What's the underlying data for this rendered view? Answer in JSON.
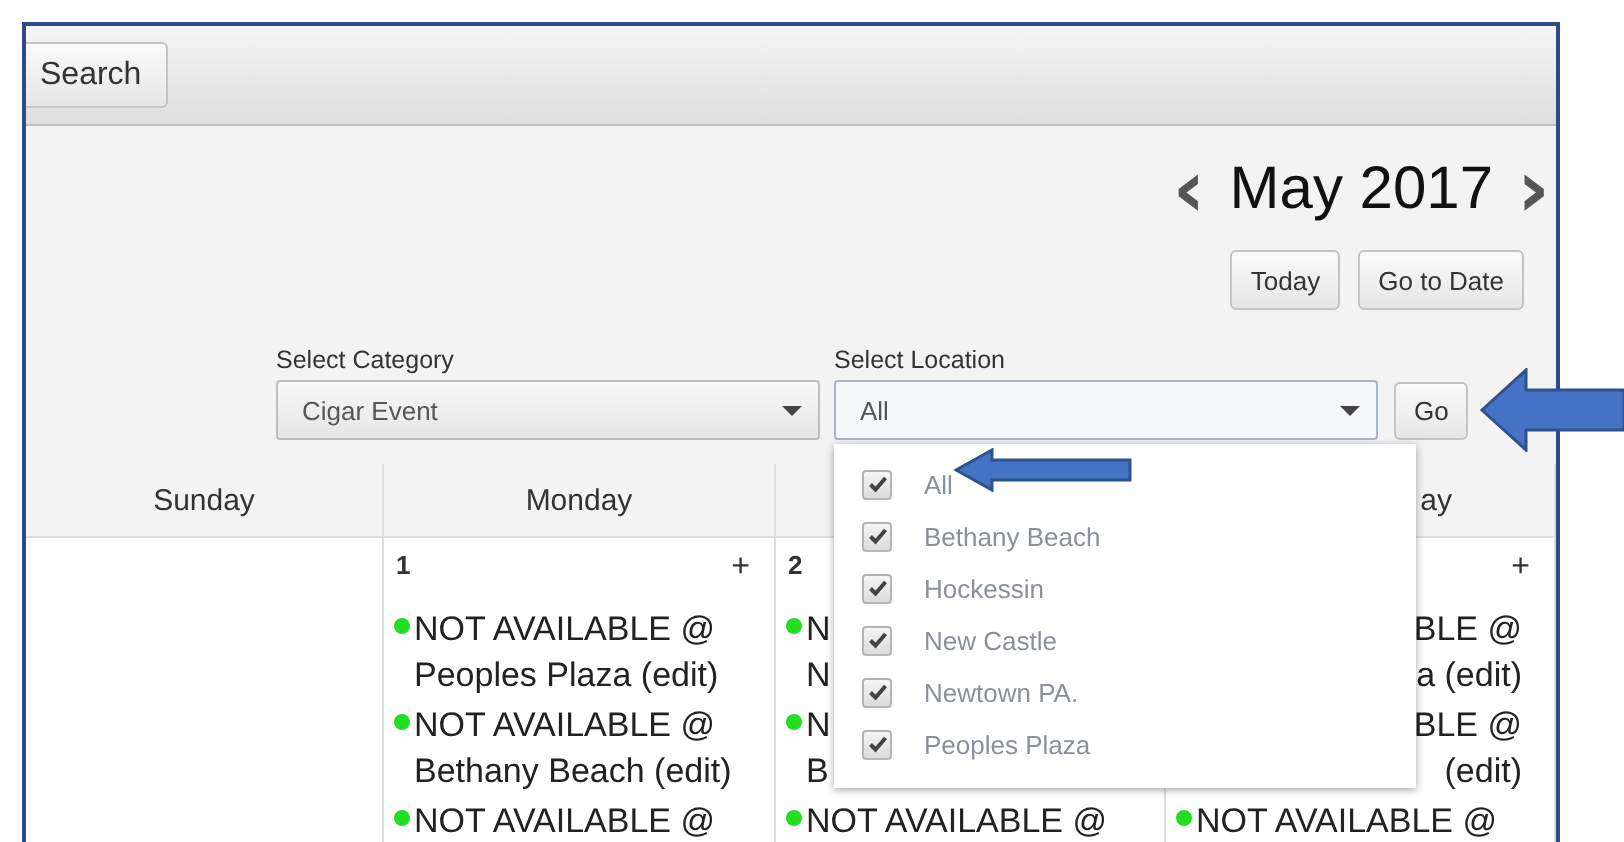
{
  "toolbar": {
    "search_button": "Search"
  },
  "navigation": {
    "prev": "‹",
    "month": "May 2017",
    "next": "›",
    "buttons": [
      "Today",
      "Go to Date"
    ]
  },
  "filters": {
    "category": {
      "label": "Select Category",
      "value": "Cigar Event"
    },
    "location": {
      "label": "Select Location",
      "value": "All",
      "expanded": true
    },
    "go_button": "Go"
  },
  "calendar": {
    "columns": [
      {
        "label": "Sunday",
        "kind": "full"
      },
      {
        "label": "Monday",
        "kind": "full"
      },
      {
        "kind": "hidden"
      },
      {
        "label": "ay",
        "kind": "partial"
      }
    ],
    "cells": [
      {},
      {
        "date": "1",
        "add": "+",
        "events": [
          {
            "kind": "full",
            "lines": [
              "NOT AVAILABLE @",
              "Peoples Plaza (edit)"
            ]
          },
          {
            "kind": "full",
            "lines": [
              "NOT AVAILABLE @",
              "Bethany Beach (edit)"
            ]
          },
          {
            "kind": "full",
            "lines": [
              "NOT AVAILABLE @"
            ]
          }
        ]
      },
      {
        "date": "2",
        "events": [
          {
            "kind": "full",
            "lines": [
              "N",
              "N"
            ]
          },
          {
            "kind": "full",
            "lines": [
              "N",
              "B"
            ]
          },
          {
            "kind": "full",
            "lines": [
              "NOT AVAILABLE @"
            ]
          }
        ]
      },
      {
        "add": "+",
        "events": [
          {
            "kind": "partial",
            "lines": [
              "BLE @",
              "a (edit)"
            ]
          },
          {
            "kind": "partial",
            "lines": [
              "BLE @",
              "(edit)"
            ]
          },
          {
            "kind": "full",
            "lines": [
              "NOT AVAILABLE @"
            ]
          }
        ]
      }
    ]
  },
  "location_options": [
    {
      "label": "All",
      "checked": true
    },
    {
      "label": "Bethany Beach",
      "checked": true
    },
    {
      "label": "Hockessin",
      "checked": true
    },
    {
      "label": "New Castle",
      "checked": true
    },
    {
      "label": "Newtown PA.",
      "checked": true
    },
    {
      "label": "Peoples Plaza",
      "checked": true
    }
  ]
}
